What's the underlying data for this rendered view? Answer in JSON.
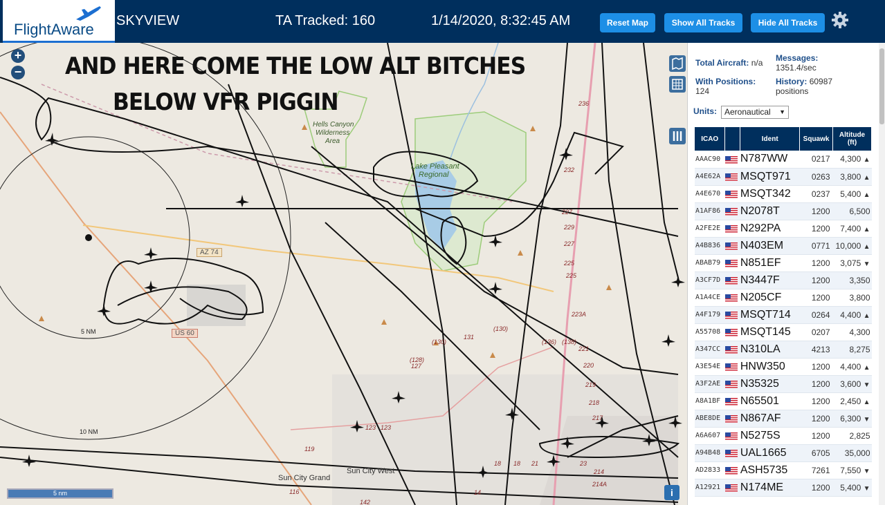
{
  "header": {
    "logo_text": "FlightAware",
    "app_name": "SKYVIEW",
    "tracked": "TA Tracked: 160",
    "datetime": "1/14/2020, 8:32:45 AM",
    "reset_map": "Reset Map",
    "show_all_tracks": "Show All Tracks",
    "hide_all_tracks": "Hide All Tracks"
  },
  "map": {
    "overlay_line1": "AND HERE COME THE LOW ALT BITCHES",
    "overlay_line2": "BELOW VFR PIGGIN",
    "zoom_in": "+",
    "zoom_out": "−",
    "scale_bar": "5 nm",
    "ring_5nm": "5 NM",
    "ring_10nm": "10 NM",
    "road_az74": "AZ 74",
    "road_us60": "US 60",
    "place_hells_canyon": "Hells Canyon",
    "place_wilderness": "Wilderness",
    "place_area": "Area",
    "place_lake_pleasant": "Lake Pleasant",
    "place_regional": "Regional",
    "place_sun_city_grand": "Sun City Grand",
    "place_sun_city_west": "Sun City West",
    "route_labels": [
      "236",
      "232",
      "227",
      "229",
      "227",
      "225",
      "225",
      "223A",
      "221",
      "220",
      "219",
      "218",
      "217",
      "(130)",
      "131",
      "(130)",
      "(136)",
      "(138)",
      "(128)",
      "127",
      "123",
      "123",
      "119",
      "116",
      "142",
      "14",
      "18",
      "18",
      "21",
      "214",
      "214A",
      "23"
    ],
    "info_btn": "i"
  },
  "stats": {
    "total_label": "Total Aircraft:",
    "total_value": "n/a",
    "messages_label": "Messages:",
    "messages_value": "1351.4/sec",
    "positions_label": "With Positions:",
    "positions_value": "124",
    "history_label": "History:",
    "history_value": "60987",
    "history_unit": "positions",
    "units_label": "Units:",
    "units_value": "Aeronautical"
  },
  "table": {
    "headers": [
      "ICAO",
      "",
      "Ident",
      "Squawk",
      "Altitude (ft)"
    ],
    "rows": [
      {
        "icao": "AAAC90",
        "ident": "N787WW",
        "squawk": "0217",
        "alt": "4,300",
        "trend": "▲"
      },
      {
        "icao": "A4E62A",
        "ident": "MSQT971",
        "squawk": "0263",
        "alt": "3,800",
        "trend": "▲"
      },
      {
        "icao": "A4E670",
        "ident": "MSQT342",
        "squawk": "0237",
        "alt": "5,400",
        "trend": "▲"
      },
      {
        "icao": "A1AF86",
        "ident": "N2078T",
        "squawk": "1200",
        "alt": "6,500",
        "trend": ""
      },
      {
        "icao": "A2FE2E",
        "ident": "N292PA",
        "squawk": "1200",
        "alt": "7,400",
        "trend": "▲"
      },
      {
        "icao": "A4B836",
        "ident": "N403EM",
        "squawk": "0771",
        "alt": "10,000",
        "trend": "▲"
      },
      {
        "icao": "ABAB79",
        "ident": "N851EF",
        "squawk": "1200",
        "alt": "3,075",
        "trend": "▼"
      },
      {
        "icao": "A3CF7D",
        "ident": "N3447F",
        "squawk": "1200",
        "alt": "3,350",
        "trend": ""
      },
      {
        "icao": "A1A4CE",
        "ident": "N205CF",
        "squawk": "1200",
        "alt": "3,800",
        "trend": ""
      },
      {
        "icao": "A4F179",
        "ident": "MSQT714",
        "squawk": "0264",
        "alt": "4,400",
        "trend": "▲"
      },
      {
        "icao": "A55708",
        "ident": "MSQT145",
        "squawk": "0207",
        "alt": "4,300",
        "trend": ""
      },
      {
        "icao": "A347CC",
        "ident": "N310LA",
        "squawk": "4213",
        "alt": "8,275",
        "trend": ""
      },
      {
        "icao": "A3E54E",
        "ident": "HNW350",
        "squawk": "1200",
        "alt": "4,400",
        "trend": "▲"
      },
      {
        "icao": "A3F2AE",
        "ident": "N35325",
        "squawk": "1200",
        "alt": "3,600",
        "trend": "▼"
      },
      {
        "icao": "A8A1BF",
        "ident": "N65501",
        "squawk": "1200",
        "alt": "2,450",
        "trend": "▲"
      },
      {
        "icao": "ABE8DE",
        "ident": "N867AF",
        "squawk": "1200",
        "alt": "6,300",
        "trend": "▼"
      },
      {
        "icao": "A6A607",
        "ident": "N5275S",
        "squawk": "1200",
        "alt": "2,825",
        "trend": ""
      },
      {
        "icao": "A94B48",
        "ident": "UAL1665",
        "squawk": "6705",
        "alt": "35,000",
        "trend": ""
      },
      {
        "icao": "AD2833",
        "ident": "ASH5735",
        "squawk": "7261",
        "alt": "7,550",
        "trend": "▼"
      },
      {
        "icao": "A12921",
        "ident": "N174ME",
        "squawk": "1200",
        "alt": "5,400",
        "trend": "▼"
      }
    ]
  }
}
